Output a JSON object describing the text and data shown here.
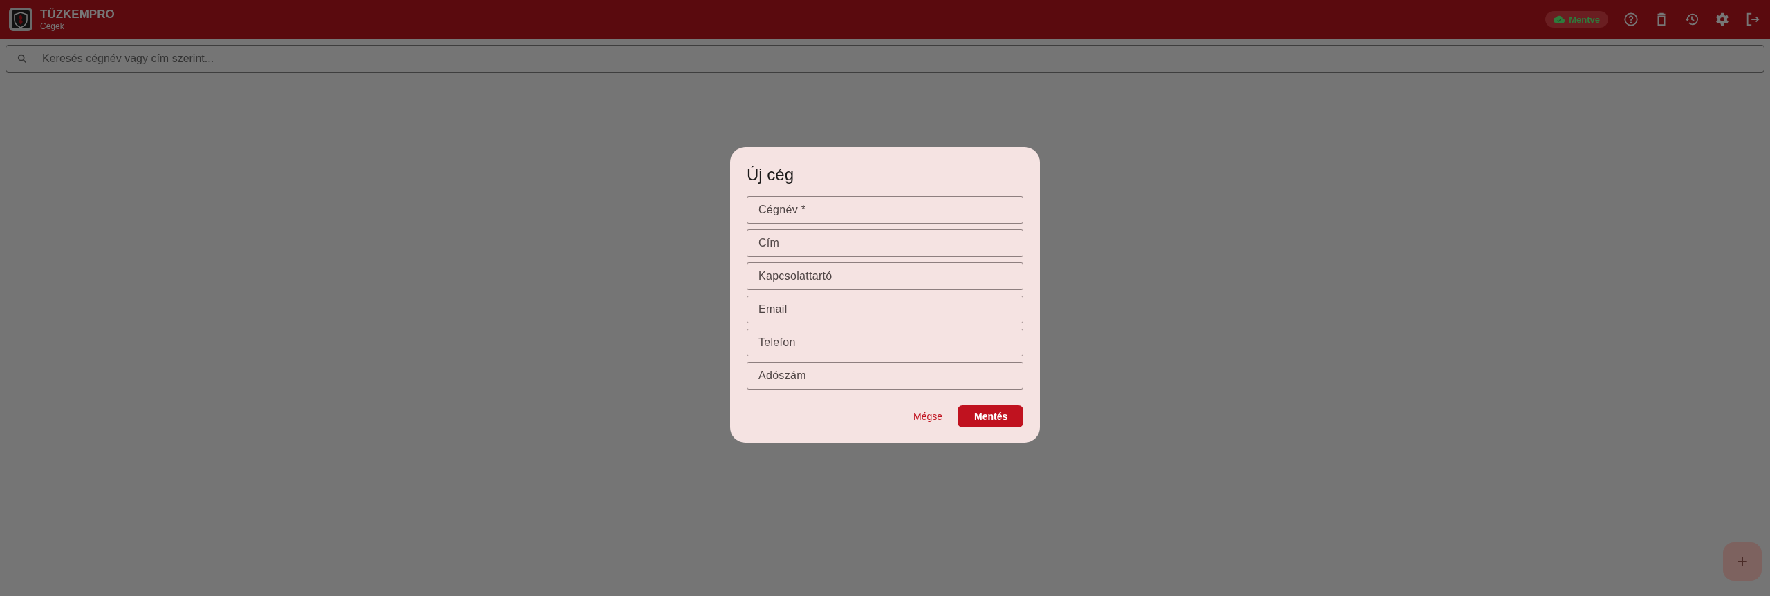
{
  "app_bar": {
    "title": "TŰZKEMPRO",
    "subtitle": "Cégek",
    "sync_status": "Mentve"
  },
  "search": {
    "placeholder": "Keresés cégnév vagy cím szerint..."
  },
  "dialog": {
    "title": "Új cég",
    "fields": [
      {
        "placeholder": "Cégnév *"
      },
      {
        "placeholder": "Cím"
      },
      {
        "placeholder": "Kapcsolattartó"
      },
      {
        "placeholder": "Email"
      },
      {
        "placeholder": "Telefon"
      },
      {
        "placeholder": "Adószám"
      }
    ],
    "buttons": [
      {
        "label": "Mégse",
        "kind": "text"
      },
      {
        "label": "Mentés",
        "kind": "filled"
      }
    ]
  }
}
